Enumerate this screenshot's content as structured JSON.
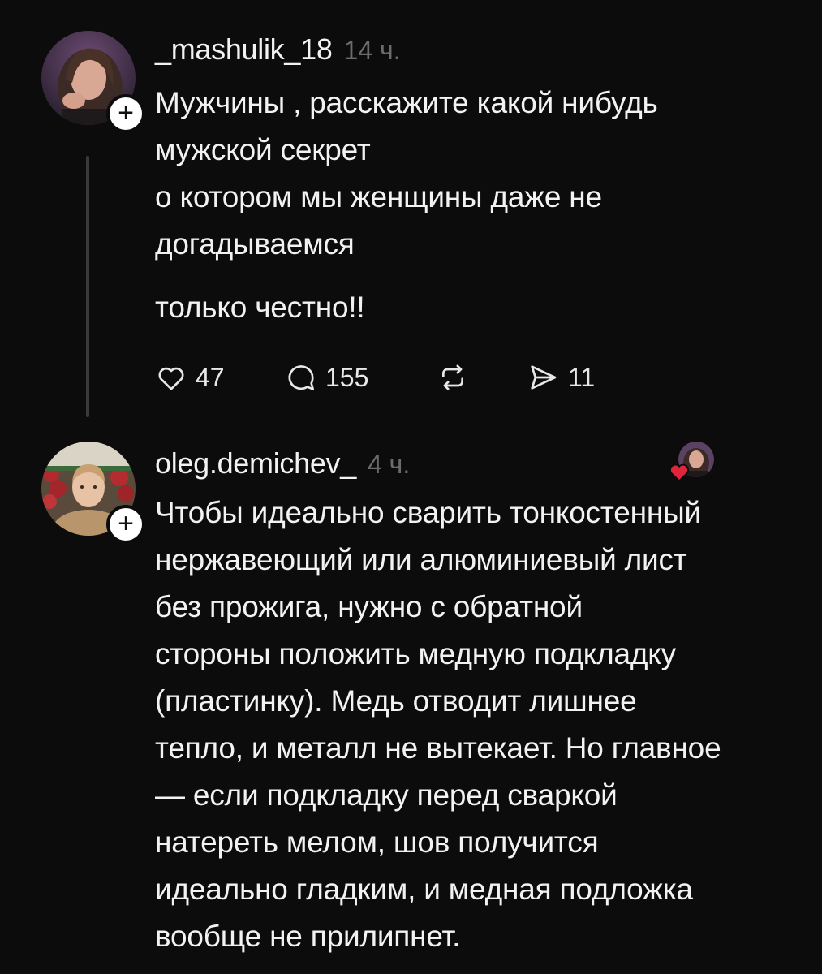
{
  "posts": [
    {
      "username": "_mashulik_18",
      "time": "14 ч.",
      "icon": "avatar-photo-woman",
      "follow_icon": "plus-icon",
      "paragraphs": [
        "Мужчины , расскажите какой нибудь\nмужской секрет\nо котором мы женщины  даже не\nдогадываемся",
        "только честно!!"
      ],
      "actions": {
        "likes": "47",
        "comments": "155",
        "shares": "11",
        "like_icon": "heart-outline-icon",
        "comment_icon": "comment-bubble-icon",
        "repost_icon": "repost-icon",
        "share_icon": "send-icon"
      }
    },
    {
      "username": "oleg.demichev_",
      "time": "4 ч.",
      "icon": "avatar-photo-man",
      "follow_icon": "plus-icon",
      "liked_by_author_icon": "heart-filled-icon",
      "paragraphs": [
        "Чтобы идеально сварить тонкостенный\nнержавеющий или алюминиевый лист\nбез прожига, нужно с обратной\nстороны положить медную подкладку\n(пластинку). Медь отводит лишнее\nтепло, и металл не вытекает. Но главное\n— если подкладку перед сваркой\nнатереть мелом, шов получится\nидеально гладким, и медная подложка\nвообще не прилипнет."
      ]
    }
  ],
  "colors": {
    "background": "#0c0c0c",
    "text": "#f2f2f2",
    "muted": "#6b6b6b",
    "thread": "#3a3a3a",
    "heart": "#e0243c"
  }
}
